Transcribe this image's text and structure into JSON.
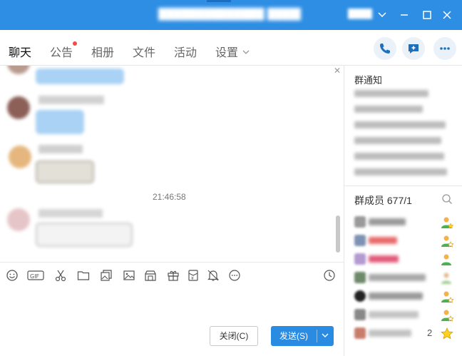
{
  "window": {
    "title": "",
    "controls": [
      "chevron-down-icon",
      "minimize-icon",
      "maximize-icon",
      "close-icon"
    ]
  },
  "tabs": [
    {
      "label": "聊天",
      "active": true
    },
    {
      "label": "公告",
      "badge": true
    },
    {
      "label": "相册"
    },
    {
      "label": "文件"
    },
    {
      "label": "活动"
    },
    {
      "label": "设置"
    }
  ],
  "header_actions": [
    "phone-icon",
    "message-plus-icon",
    "more-icon"
  ],
  "chat": {
    "timestamp": "21:46:58"
  },
  "toolbar_icons": [
    "emoji-icon",
    "gif-icon",
    "scissors-icon",
    "folder-icon",
    "image-gallery-icon",
    "image-icon",
    "gift-shop-icon",
    "gift-icon",
    "red-packet-icon",
    "bell-icon",
    "more-circle-icon",
    "history-icon"
  ],
  "buttons": {
    "close_label": "关闭(C)",
    "send_label": "发送(S)"
  },
  "sidebar": {
    "notice_title": "群通知",
    "members_title": "群成员 677/1",
    "last_member_count": "2"
  },
  "colors": {
    "titlebar": "#2d8ee3",
    "send_button": "#2a8be2",
    "badge": "#f24b4b"
  }
}
